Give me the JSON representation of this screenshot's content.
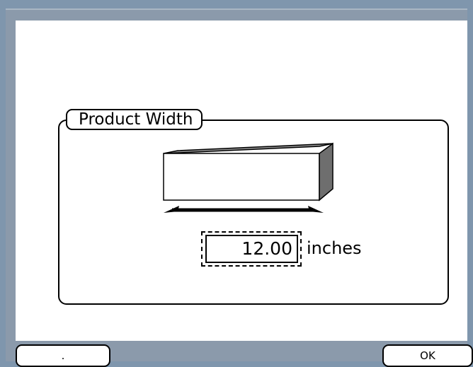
{
  "dialog": {
    "group_title": "Product Width",
    "width_value": "12.00",
    "unit": "inches"
  },
  "buttons": {
    "left_label": ".",
    "ok_label": "OK"
  },
  "icons": {
    "illustration": "box-width-illustration",
    "arrow": "width-arrow-icon"
  }
}
